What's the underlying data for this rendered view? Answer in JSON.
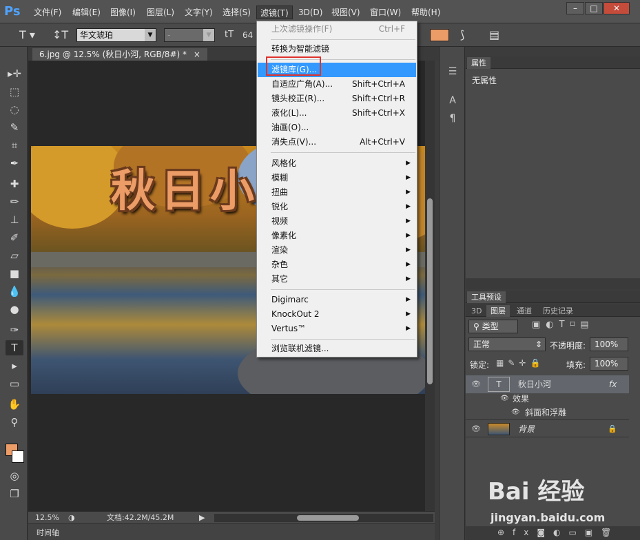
{
  "menubar": {
    "logo": "Ps",
    "items": [
      "文件(F)",
      "编辑(E)",
      "图像(I)",
      "图层(L)",
      "文字(Y)",
      "选择(S)",
      "滤镜(T)",
      "3D(D)",
      "视图(V)",
      "窗口(W)",
      "帮助(H)"
    ],
    "window_buttons": [
      "–",
      "□",
      "✕"
    ]
  },
  "options": {
    "font_family": "华文琥珀",
    "font_style": "-",
    "font_size_partial": "64",
    "text_color": "#ec9c66"
  },
  "document": {
    "tab_label": "6.jpg @ 12.5% (秋日小河, RGB/8#) *",
    "close": "×",
    "image_text": "秋日小"
  },
  "statusbar": {
    "zoom": "12.5%",
    "doc_info": "文档:42.2M/45.2M"
  },
  "timeline": {
    "label": "时间轴"
  },
  "properties": {
    "tab": "属性",
    "content": "无属性"
  },
  "tool_presets": {
    "tab": "工具预设"
  },
  "layers_panel": {
    "tabs": [
      "3D",
      "图层",
      "通道",
      "历史记录"
    ],
    "filter_type": "类型",
    "blend_mode": "正常",
    "opacity_label": "不透明度:",
    "opacity_value": "100%",
    "lock_label": "锁定:",
    "fill_label": "填充:",
    "fill_value": "100%",
    "layers": [
      {
        "name": "秋日小河",
        "type_glyph": "T",
        "fx": "fx"
      },
      {
        "name": "效果"
      },
      {
        "name": "斜面和浮雕"
      },
      {
        "name": "背景"
      }
    ]
  },
  "filter_menu": {
    "items": [
      {
        "label": "上次滤镜操作(F)",
        "shortcut": "Ctrl+F",
        "disabled": true
      },
      {
        "label": "转换为智能滤镜"
      },
      {
        "label": "滤镜库(G)..."
      },
      {
        "label": "自适应广角(A)...",
        "shortcut": "Shift+Ctrl+A"
      },
      {
        "label": "镜头校正(R)...",
        "shortcut": "Shift+Ctrl+R"
      },
      {
        "label": "液化(L)...",
        "shortcut": "Shift+Ctrl+X"
      },
      {
        "label": "油画(O)..."
      },
      {
        "label": "消失点(V)...",
        "shortcut": "Alt+Ctrl+V"
      },
      {
        "label": "风格化"
      },
      {
        "label": "模糊"
      },
      {
        "label": "扭曲"
      },
      {
        "label": "锐化"
      },
      {
        "label": "视频"
      },
      {
        "label": "像素化"
      },
      {
        "label": "渲染"
      },
      {
        "label": "杂色"
      },
      {
        "label": "其它"
      },
      {
        "label": "Digimarc"
      },
      {
        "label": "KnockOut 2"
      },
      {
        "label": "Vertus™"
      },
      {
        "label": "浏览联机滤镜..."
      }
    ],
    "submenu_arrow": "▶"
  },
  "watermark": {
    "logo": "Bai 经验",
    "url": "jingyan.baidu.com"
  }
}
